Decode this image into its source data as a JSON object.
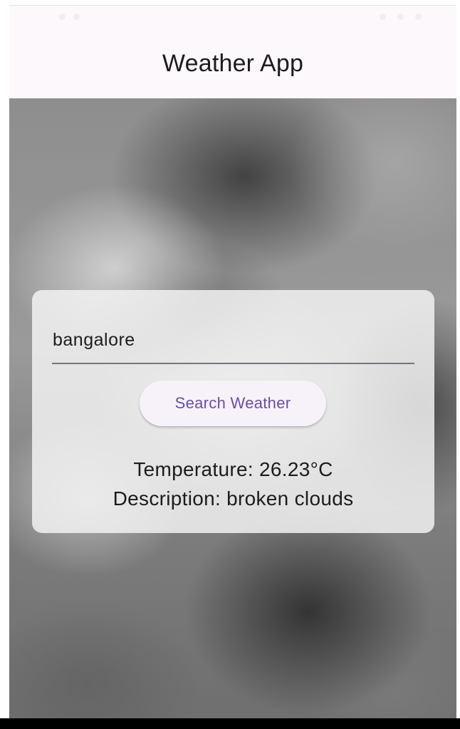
{
  "app_bar": {
    "title": "Weather App"
  },
  "search": {
    "city_value": "bangalore",
    "button_label": "Search Weather"
  },
  "result": {
    "temperature_text": "Temperature: 26.23°C",
    "description_text": "Description: broken clouds"
  },
  "colors": {
    "app_bar_background": "#fdf8fc",
    "button_text": "#6750a4",
    "button_background": "#f7f2fa",
    "text_primary": "#1d1b20"
  }
}
